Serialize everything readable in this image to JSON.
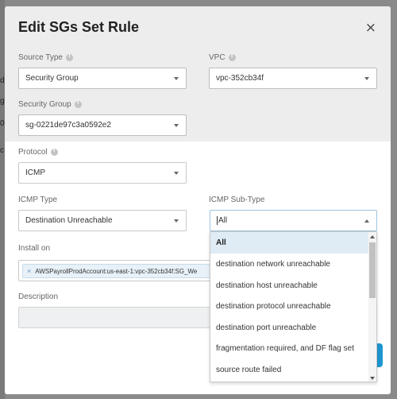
{
  "modal": {
    "title": "Edit SGs Set Rule",
    "close_icon": "×"
  },
  "source_type": {
    "label": "Source Type",
    "value": "Security Group"
  },
  "vpc": {
    "label": "VPC",
    "value": "vpc-352cb34f"
  },
  "security_group": {
    "label": "Security Group",
    "value": "sg-0221de97c3a0592e2"
  },
  "protocol": {
    "label": "Protocol",
    "value": "ICMP"
  },
  "icmp_type": {
    "label": "ICMP Type",
    "value": "Destination Unreachable"
  },
  "icmp_subtype": {
    "label": "ICMP Sub-Type",
    "value": "All",
    "options": [
      "All",
      "destination network unreachable",
      "destination host unreachable",
      "destination protocol unreachable",
      "destination port unreachable",
      "fragmentation required, and DF flag set",
      "source route failed"
    ]
  },
  "install_on": {
    "label": "Install on",
    "chip_remove": "×",
    "chip_text": "AWSPayrollProdAccount:us-east-1:vpc-352cb34f:SG_We"
  },
  "description": {
    "label": "Description",
    "value": ""
  },
  "background_chars": [
    "d",
    "g",
    "0",
    "c"
  ],
  "colors": {
    "accent": "#1e96d1",
    "selected_option": "#e0ecf5",
    "chip_background": "#e8f1f8"
  }
}
